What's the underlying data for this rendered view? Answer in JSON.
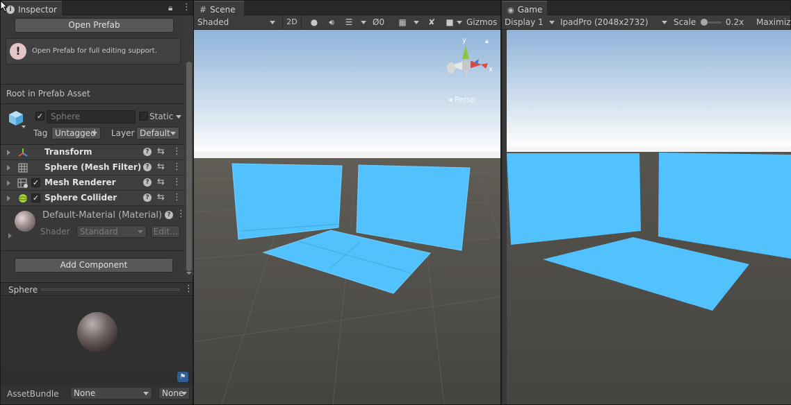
{
  "inspector": {
    "tab_label": "Inspector",
    "open_prefab_label": "Open Prefab",
    "info_message": "Open Prefab for full editing support.",
    "root_label": "Root in Prefab Asset",
    "object_name": "Sphere",
    "static_label": "Static",
    "tag_label": "Tag",
    "tag_value": "Untagged",
    "layer_label": "Layer",
    "layer_value": "Default",
    "components": [
      {
        "label": "Transform",
        "has_checkbox": false
      },
      {
        "label": "Sphere (Mesh Filter)",
        "has_checkbox": false
      },
      {
        "label": "Mesh Renderer",
        "has_checkbox": true
      },
      {
        "label": "Sphere Collider",
        "has_checkbox": true
      }
    ],
    "material_label": "Default-Material (Material)",
    "shader_label": "Shader",
    "shader_value": "Standard",
    "edit_label": "Edit...",
    "add_component_label": "Add Component",
    "preview_title": "Sphere",
    "assetbundle_label": "AssetBundle",
    "assetbundle_value": "None",
    "assetbundle_variant": "None"
  },
  "scene": {
    "tab_label": "Scene",
    "shading_mode": "Shaded",
    "mode_2d": "2D",
    "hidden_count": "0",
    "gizmos_label": "Gizmos",
    "persp_label": "Persp",
    "axis_x": "x",
    "axis_y": "y"
  },
  "game": {
    "tab_label": "Game",
    "display": "Display 1",
    "resolution": "IpadPro (2048x2732)",
    "scale_label": "Scale",
    "scale_value": "0.2x",
    "maximize_label": "Maximiz"
  },
  "colors": {
    "sky_top": "#8fb3d9",
    "horizon": "#ffffff",
    "ground": "#4a4843",
    "plane": "#52c2ff",
    "accent": "#3d6ab4"
  }
}
